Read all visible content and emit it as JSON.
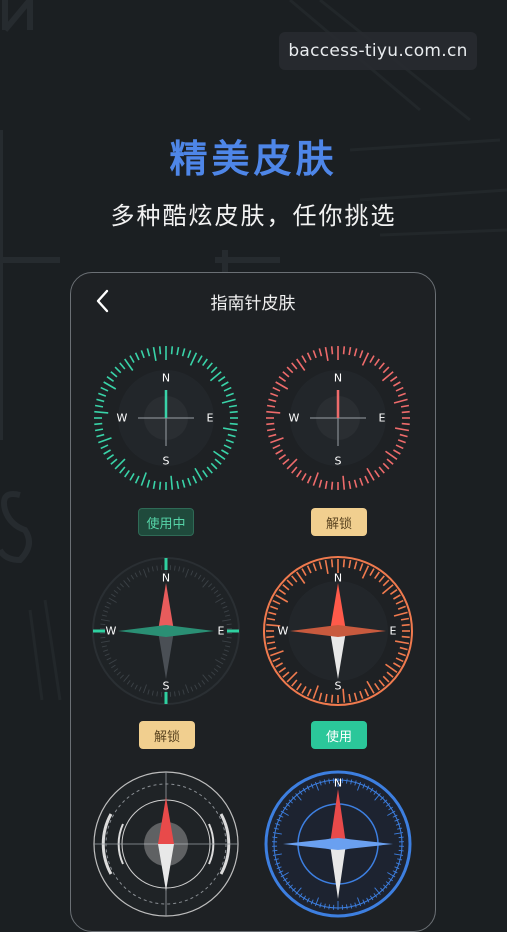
{
  "watermark": "baccess-tiyu.com.cn",
  "headline": "精美皮肤",
  "subline": "多种酷炫皮肤，任你挑选",
  "phone": {
    "title": "指南针皮肤",
    "back_icon": "chevron-left-icon"
  },
  "compass_letters": {
    "n": "N",
    "e": "E",
    "s": "S",
    "w": "W"
  },
  "skins": [
    {
      "style": "teal-ticks",
      "accent": "#39d3a8",
      "button": "使用中"
    },
    {
      "style": "coral-ticks",
      "accent": "#ee6b6b",
      "button": "解锁"
    },
    {
      "style": "dark-star",
      "accent": "#2fd0a0",
      "button": "解锁"
    },
    {
      "style": "orange-star",
      "accent": "#f07a4e",
      "button": "使用"
    },
    {
      "style": "grey-tech",
      "accent": "#c8c8c8",
      "button": ""
    },
    {
      "style": "blue-star",
      "accent": "#3d7fe0",
      "button": ""
    }
  ],
  "colors": {
    "headline": "#4e86e8",
    "inuse_bg": "#1f4a3c",
    "unlock_bg": "#f1cf8f",
    "use_bg": "#2bc79a"
  }
}
